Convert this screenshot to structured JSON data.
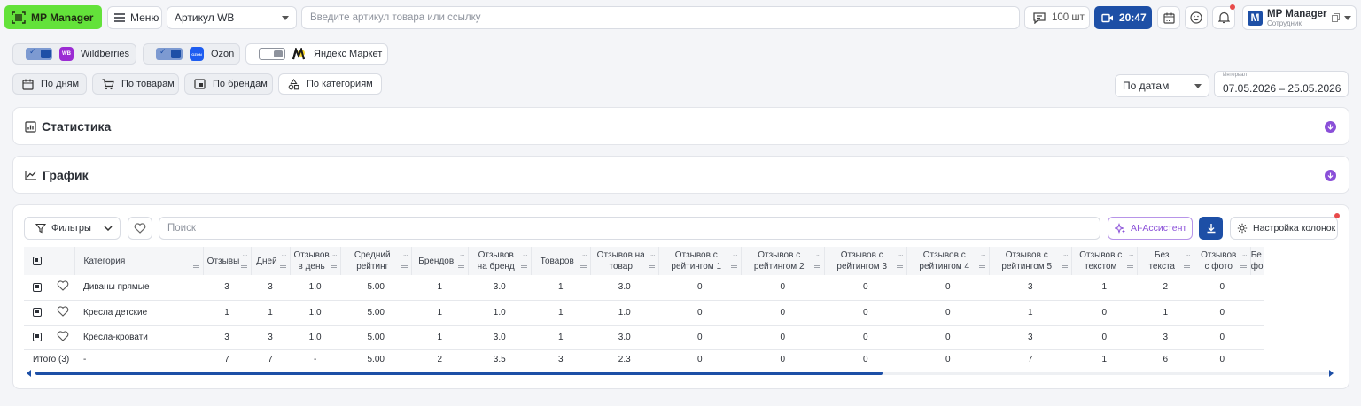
{
  "header": {
    "logo": "MP Manager",
    "menu": "Меню",
    "articul_select": "Артикул WB",
    "search_placeholder": "Введите артикул товара или ссылку",
    "count": "100 шт",
    "time": "20:47",
    "profile_name": "MP Manager",
    "profile_role": "Сотрудник",
    "profile_letter": "M"
  },
  "marketplaces": [
    {
      "name": "Wildberries",
      "on": true,
      "logo": "WB",
      "color": "#9b2bd3"
    },
    {
      "name": "Ozon",
      "on": true,
      "logo": "OZON",
      "color": "#1d5cf0"
    },
    {
      "name": "Яндекс Маркет",
      "on": false,
      "logo": "ЯМ",
      "color": "#f7d51a"
    }
  ],
  "group_tabs": [
    {
      "label": "По дням",
      "icon": "calendar-icon"
    },
    {
      "label": "По товарам",
      "icon": "cart-icon"
    },
    {
      "label": "По брендам",
      "icon": "brand-icon"
    },
    {
      "label": "По категориям",
      "icon": "shapes-icon",
      "active": true
    }
  ],
  "period": {
    "select": "По датам",
    "interval_label": "Интервал",
    "interval": "07.05.2026 – 25.05.2026"
  },
  "panels": {
    "stats": "Статистика",
    "chart": "График"
  },
  "toolbar": {
    "filters": "Фильтры",
    "search_placeholder": "Поиск",
    "ai": "AI-Ассистент",
    "columns": "Настройка колонок"
  },
  "table": {
    "headers": [
      "Категория",
      "Отзывы",
      "Дней",
      "Отзывов в день",
      "Средний рейтинг",
      "Брендов",
      "Отзывов на бренд",
      "Товаров",
      "Отзывов на товар",
      "Отзывов с рейтингом 1",
      "Отзывов с рейтингом 2",
      "Отзывов с рейтингом 3",
      "Отзывов с рейтингом 4",
      "Отзывов с рейтингом 5",
      "Отзывов с текстом",
      "Без текста",
      "Отзывов с фото",
      "Бе фо"
    ],
    "rows": [
      [
        "Диваны прямые",
        "3",
        "3",
        "1.0",
        "5.00",
        "1",
        "3.0",
        "1",
        "3.0",
        "0",
        "0",
        "0",
        "0",
        "3",
        "1",
        "2",
        "0",
        ""
      ],
      [
        "Кресла детские",
        "1",
        "1",
        "1.0",
        "5.00",
        "1",
        "1.0",
        "1",
        "1.0",
        "0",
        "0",
        "0",
        "0",
        "1",
        "0",
        "1",
        "0",
        ""
      ],
      [
        "Кресла-кровати",
        "3",
        "3",
        "1.0",
        "5.00",
        "1",
        "3.0",
        "1",
        "3.0",
        "0",
        "0",
        "0",
        "0",
        "3",
        "0",
        "3",
        "0",
        ""
      ]
    ],
    "total": [
      "Итого (3)",
      "-",
      "7",
      "7",
      "-",
      "5.00",
      "2",
      "3.5",
      "3",
      "2.3",
      "0",
      "0",
      "0",
      "0",
      "7",
      "1",
      "6",
      "0",
      ""
    ]
  },
  "colors": {
    "accent": "#1d4fa6",
    "logo_green": "#63e23a",
    "purple": "#8a4fd8"
  }
}
